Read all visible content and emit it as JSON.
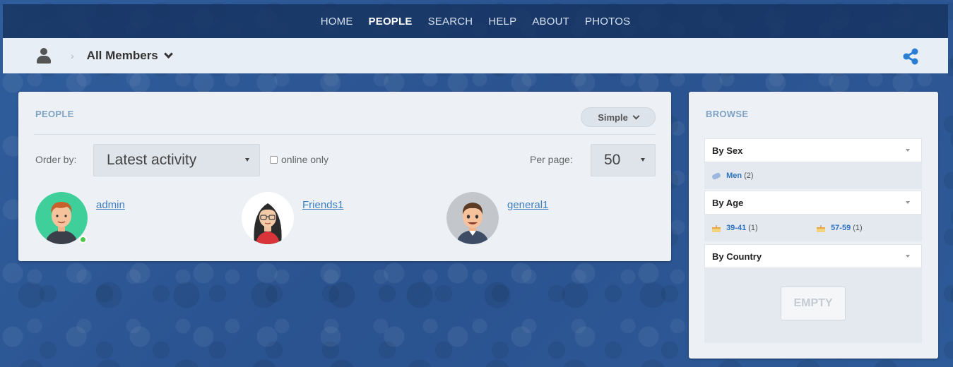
{
  "nav": {
    "items": [
      {
        "label": "HOME",
        "active": false
      },
      {
        "label": "PEOPLE",
        "active": true
      },
      {
        "label": "SEARCH",
        "active": false
      },
      {
        "label": "HELP",
        "active": false
      },
      {
        "label": "ABOUT",
        "active": false
      },
      {
        "label": "PHOTOS",
        "active": false
      }
    ]
  },
  "breadcrumb": {
    "separator": "›",
    "title": "All Members"
  },
  "people": {
    "title": "PEOPLE",
    "view_mode": "Simple",
    "order_label": "Order by:",
    "order_value": "Latest activity",
    "online_only_label": "online only",
    "per_page_label": "Per page:",
    "per_page_value": "50",
    "members": [
      {
        "name": "admin",
        "online": true
      },
      {
        "name": "Friends1",
        "online": false
      },
      {
        "name": "general1",
        "online": false
      }
    ]
  },
  "browse": {
    "title": "BROWSE",
    "by_sex": {
      "label": "By Sex",
      "items": [
        {
          "label": "Men",
          "count": "(2)"
        }
      ]
    },
    "by_age": {
      "label": "By Age",
      "items": [
        {
          "label": "39-41",
          "count": "(1)"
        },
        {
          "label": "57-59",
          "count": "(1)"
        }
      ]
    },
    "by_country": {
      "label": "By Country",
      "empty_label": "EMPTY"
    }
  },
  "colors": {
    "accent": "#3c7fc1",
    "nav_bg": "#163462",
    "panel_bg": "#edf1f6",
    "online": "#4cc84a"
  }
}
